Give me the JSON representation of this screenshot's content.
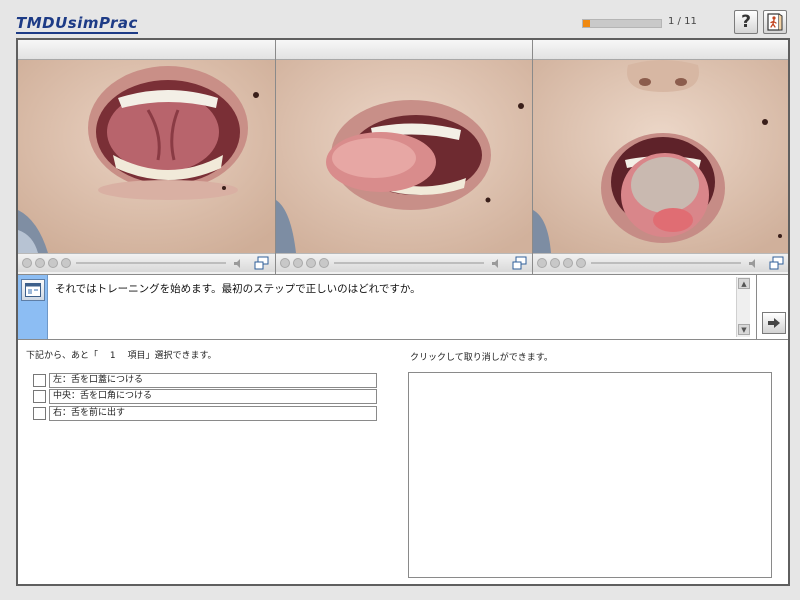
{
  "header": {
    "logo": "TMDUsimPrac",
    "progress": {
      "current": 1,
      "total": 11,
      "fraction": 0.09,
      "text": "1 / 11"
    },
    "help_label": "?",
    "help_icon": "question-icon",
    "exit_icon": "exit-door-icon"
  },
  "videos": [
    {
      "title": "",
      "subject": "open-mouth-tongue-raised"
    },
    {
      "title": "",
      "subject": "tongue-to-mouth-corner"
    },
    {
      "title": "",
      "subject": "tongue-protruded"
    }
  ],
  "question": {
    "icon": "window-icon",
    "text": "それではトレーニングを始めます。最初のステップで正しいのはどれですか。",
    "next_icon": "arrow-right-icon"
  },
  "answers": {
    "instruction": "下記から、あと「　 1 　項目」選択できます。",
    "undo_hint": "クリックして取り消しができます。",
    "options": [
      {
        "label": "左：舌を口蓋につける",
        "checked": false
      },
      {
        "label": "中央：舌を口角につける",
        "checked": false
      },
      {
        "label": "右：舌を前に出す",
        "checked": false
      }
    ]
  },
  "colors": {
    "accent_blue": "#8cbdf3",
    "progress_orange": "#f08a12",
    "logo_blue": "#1d3b86"
  }
}
